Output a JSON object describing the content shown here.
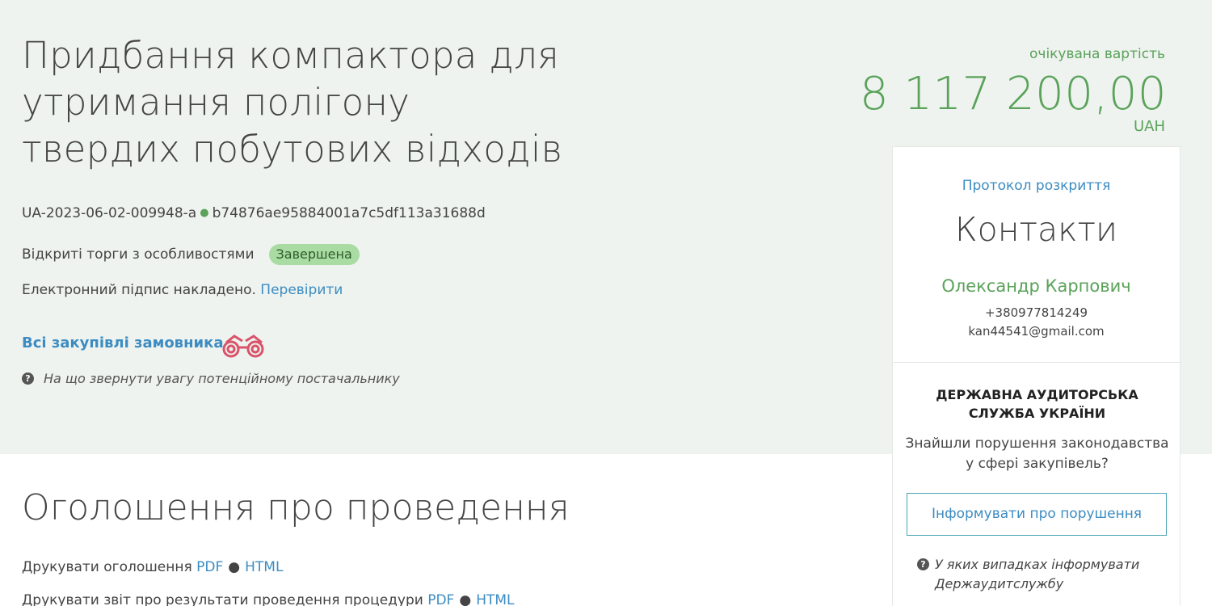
{
  "tender": {
    "title": "Придбання компактора для утримання полігону твердих побутових відходів",
    "id": "UA-2023-06-02-009948-a",
    "hash": "b74876ae95884001a7c5df113a31688d",
    "procedure_type": "Відкриті торги з особливостями",
    "status": "Завершена",
    "status_color": "#a9dca2",
    "signature_text": "Електронний підпис накладено.",
    "signature_link": "Перевірити",
    "all_purchases_link": "Всі закупівлі замовника",
    "supplier_hint": "На що звернути увагу потенційному постачальнику"
  },
  "price": {
    "label": "очікувана вартість",
    "value": "8 117 200,00",
    "currency": "UAH",
    "color": "#5aa25a"
  },
  "sidebar": {
    "protocol_link": "Протокол розкриття",
    "contacts_title": "Контакти",
    "contact_name": "Олександр Карпович",
    "contact_phone": "+380977814249",
    "contact_email": "kan44541@gmail.com",
    "audit_title": "ДЕРЖАВНА АУДИТОРСЬКА СЛУЖБА УКРАЇНИ",
    "audit_question": "Знайшли порушення законодавства у сфері закупівель?",
    "audit_button": "Інформувати про порушення",
    "audit_hint": "У яких випадках інформувати Держаудитслужбу"
  },
  "announcement": {
    "title": "Оголошення про проведення",
    "print_notice_label": "Друкувати оголошення",
    "print_report_label": "Друкувати звіт про результати проведення процедури",
    "pdf": "PDF",
    "html": "HTML",
    "bullet": "●"
  },
  "icons": {
    "binoculars": "binoculars-icon",
    "question": "question-circle-icon"
  },
  "colors": {
    "hero_bg": "#eef3ef",
    "link": "#3c8cc2",
    "accent_green": "#5aa25a"
  }
}
